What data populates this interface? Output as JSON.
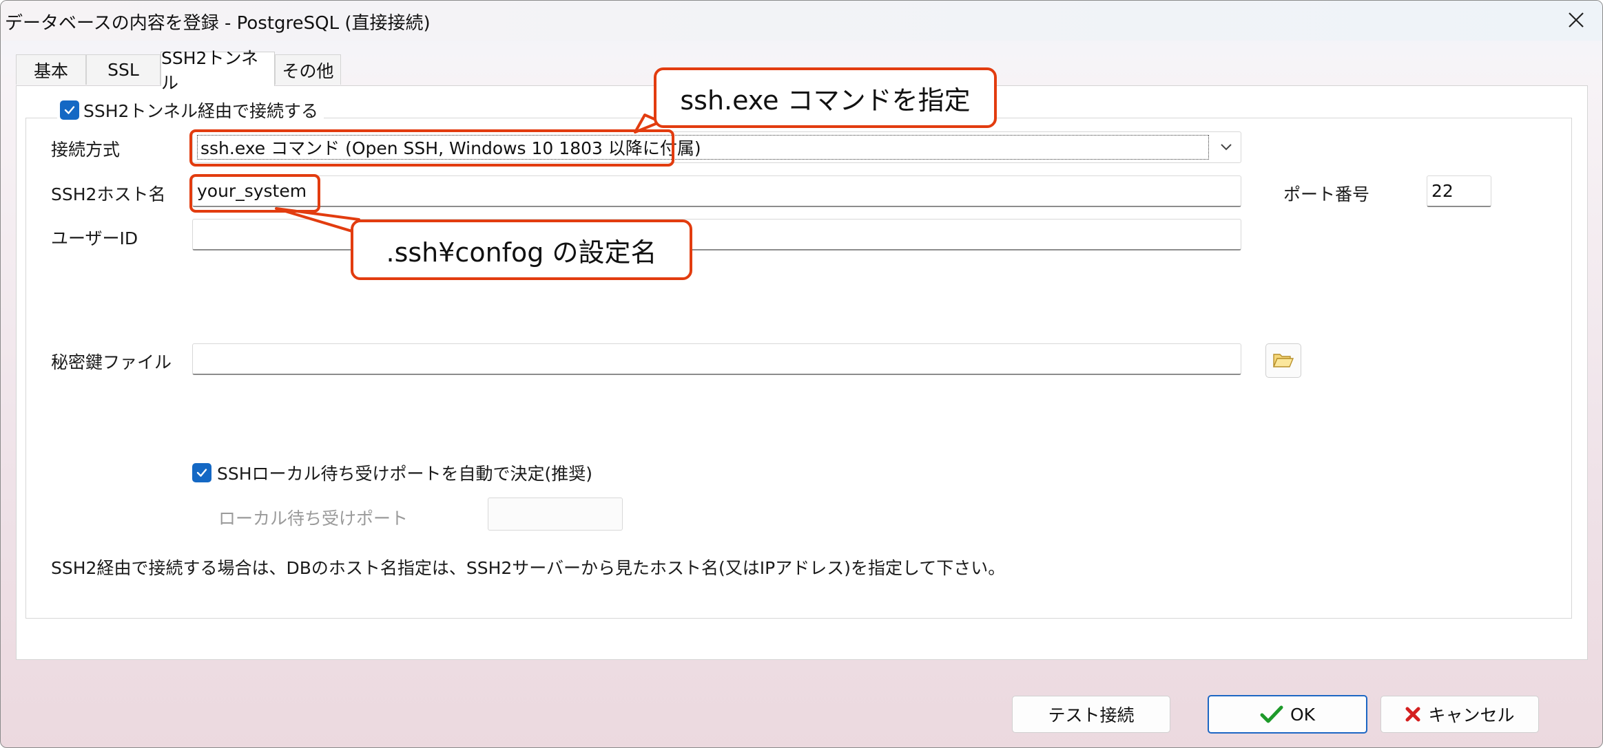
{
  "window": {
    "title": "データベースの内容を登録 - PostgreSQL (直接接続)"
  },
  "tabs": [
    {
      "label": "基本"
    },
    {
      "label": "SSL"
    },
    {
      "label": "SSH2トンネル",
      "active": true
    },
    {
      "label": "その他"
    }
  ],
  "ssh": {
    "use_tunnel_label": "SSH2トンネル経由で接続する",
    "use_tunnel_checked": true,
    "method_label": "接続方式",
    "method_value": "ssh.exe コマンド (Open SSH, Windows 10 1803 以降に付属)",
    "host_label": "SSH2ホスト名",
    "host_value": "your_system",
    "port_label": "ポート番号",
    "port_value": "22",
    "user_label": "ユーザーID",
    "user_value": "",
    "keyfile_label": "秘密鍵ファイル",
    "keyfile_value": "",
    "auto_port_label": "SSHローカル待ち受けポートを自動で決定(推奨)",
    "auto_port_checked": true,
    "local_port_label": "ローカル待ち受けポート",
    "local_port_value": "",
    "note": "SSH2経由で接続する場合は、DBのホスト名指定は、SSH2サーバーから見たホスト名(又はIPアドレス)を指定して下さい。"
  },
  "buttons": {
    "test": "テスト接続",
    "ok": "OK",
    "cancel": "キャンセル"
  },
  "annotations": {
    "callout_method": "ssh.exe コマンドを指定",
    "callout_host": ".ssh¥confog の設定名",
    "color": "#e23c0f"
  },
  "icons": {
    "close": "close-icon",
    "dropdown": "chevron-down-icon",
    "folder": "folder-open-icon",
    "ok": "checkmark-icon",
    "cancel": "x-icon"
  }
}
